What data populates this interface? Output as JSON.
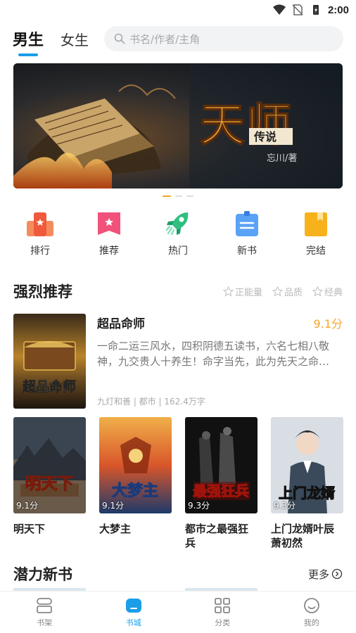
{
  "status": {
    "time": "2:00"
  },
  "gender_tabs": [
    {
      "label": "男生",
      "active": true
    },
    {
      "label": "女生",
      "active": false
    }
  ],
  "search": {
    "placeholder": "书名/作者/主角"
  },
  "banner": {
    "title": "天师",
    "subtitle": "传说",
    "author": "忘川/著"
  },
  "categories": [
    {
      "label": "排行",
      "icon": "rank-icon",
      "color": "#f06a4a"
    },
    {
      "label": "推荐",
      "icon": "recommend-icon",
      "color": "#f0527a"
    },
    {
      "label": "热门",
      "icon": "rocket-icon",
      "color": "#2fbf7f"
    },
    {
      "label": "新书",
      "icon": "new-book-icon",
      "color": "#3d8cf0"
    },
    {
      "label": "完结",
      "icon": "completed-icon",
      "color": "#f7b21b"
    }
  ],
  "strong_recommend": {
    "title": "强烈推荐",
    "tags": [
      "正能量",
      "品质",
      "经典"
    ],
    "featured": {
      "title": "超品命师",
      "score": "9.1分",
      "description": "一命二运三风水，四积阴德五读书，六名七相八敬神，九交贵人十养生！命字当先，此为先天之命…",
      "meta": "九灯和善 | 都市 | 162.4万字",
      "cover_text": "超品命师"
    },
    "books": [
      {
        "title": "明天下",
        "score": "9.1分",
        "cover_text": "明天下"
      },
      {
        "title": "大梦主",
        "score": "9.1分",
        "cover_text": "大梦主"
      },
      {
        "title": "都市之最强狂兵",
        "score": "9.3分",
        "cover_text": "最强狂兵"
      },
      {
        "title": "上门龙婿叶辰萧初然",
        "score": "9.3分",
        "cover_text": "上门龙婿"
      }
    ]
  },
  "potential": {
    "title": "潜力新书",
    "more": "更多"
  },
  "bottom_nav": [
    {
      "label": "书架",
      "active": false
    },
    {
      "label": "书城",
      "active": true
    },
    {
      "label": "分类",
      "active": false
    },
    {
      "label": "我的",
      "active": false
    }
  ]
}
